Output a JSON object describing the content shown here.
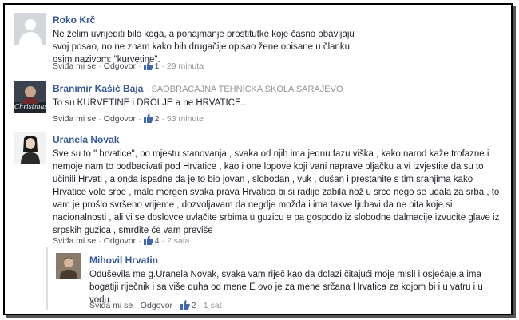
{
  "comments": [
    {
      "name": "Roko Krč",
      "affiliation": "",
      "text": "Ne želim uvrijediti bilo koga, a ponajmanje prostitutke koje časno obavljaju svoj posao, no ne znam kako bih drugačije opisao žene opisane u članku osim nazivom: \"kurvetine\".",
      "like": "Sviđa mi se",
      "reply": "Odgovor",
      "likes": "1",
      "time": "29 minuta",
      "like_icon": "thumbs-up-icon"
    },
    {
      "name": "Branimir Kašić Baja",
      "affiliation": "· SAOBRACAJNA TEHNICKA SKOLA SARAJEVO",
      "avatar_text": "Christmas",
      "text": "To su KURVETINE i DROLJE a ne HRVATICE..",
      "like": "Sviđa mi se",
      "reply": "Odgovor",
      "likes": "2",
      "time": "53 minute"
    },
    {
      "name": "Uranela Novak",
      "affiliation": "",
      "text": "Sve su to \" hrvatice\", po mjestu stanovanja , svaka od njih ima jednu fazu viška , kako narod kaže trofazne i nemoje nam to podbacivati pod Hrvatice , kao i one lopove koji vani naprave pljačku a vi izvjestite da su to učinili Hrvati , a onda ispadne da je to bio jovan , slobodan , vuk , dušan i prestanite s tim sranjima kako Hrvatice vole srbe , malo morgen svaka prava Hrvatica bi si radije zabila nož u srce nego se udala za srba , to vam je prošlo svršeno vrijeme , dozvoljavam da negdje možda i ima takve ljubavi da ne pita koje si nacionalnosti , ali vi se doslovce uvlačite srbima u guzicu e pa gospodo iz slobodne dalmacije izvucite glave iz srpskih guzica , smrdite će vam previše",
      "like": "Sviđa mi se",
      "reply": "Odgovor",
      "likes": "4",
      "time": "2 sata"
    },
    {
      "name": "Mihovil Hrvatin",
      "affiliation": "",
      "text": "Oduševila me g.Uranela Novak, svaka vam riječ kao da dolazi čitajući moje misli i osjećaje,a ima bogatiji riječnik i sa više duha od mene.E ovo je za mene srčana Hrvatica za kojom bi i u vatru i u vodu.",
      "like": "Sviđa mi se",
      "reply": "Odgovor",
      "likes": "2",
      "time": "1 sat"
    }
  ]
}
